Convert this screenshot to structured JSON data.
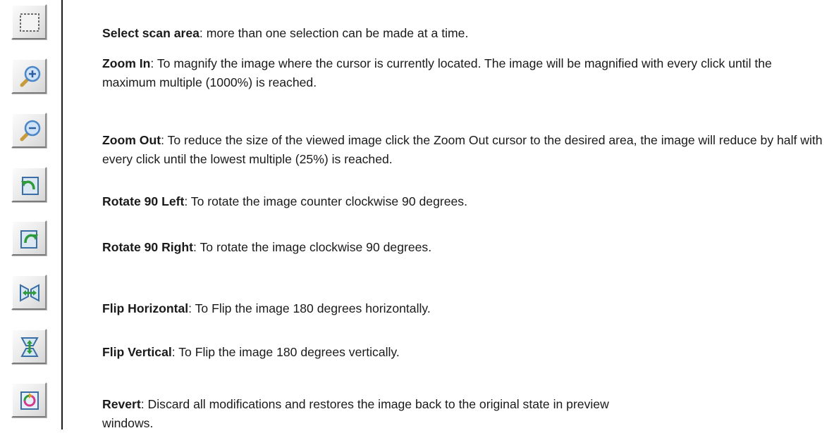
{
  "toolbar": {
    "buttons": [
      {
        "icon": "select-area-icon",
        "name": "Select scan area",
        "description": ": more than one selection can be made at a time."
      },
      {
        "icon": "zoom-in-icon",
        "name": "Zoom In",
        "description": ": To magnify the image where the cursor is currently located. The image will be magnified with every click until the maximum multiple (1000%) is reached."
      },
      {
        "icon": "zoom-out-icon",
        "name": "Zoom Out",
        "description": ": To reduce the size of the viewed image click the Zoom Out cursor to the desired area, the image will reduce by half with every click until the lowest multiple (25%) is reached."
      },
      {
        "icon": "rotate-left-icon",
        "name": "Rotate 90 Left",
        "description": ": To rotate the image counter clockwise 90 degrees."
      },
      {
        "icon": "rotate-right-icon",
        "name": "Rotate 90 Right",
        "description": ": To rotate the image clockwise 90 degrees."
      },
      {
        "icon": "flip-horizontal-icon",
        "name": "Flip Horizontal",
        "description": ": To Flip the image 180 degrees horizontally."
      },
      {
        "icon": "flip-vertical-icon",
        "name": "Flip Vertical",
        "description": ": To Flip the image 180 degrees vertically."
      },
      {
        "icon": "revert-icon",
        "name": "Revert",
        "description": ": Discard all modifications and restores the image back to the original state in preview windows."
      }
    ]
  },
  "colors": {
    "text": "#1a1a1a",
    "button_face": "#e9e9e9",
    "magnifier_blue": "#4b86c9",
    "handle_gold": "#c79a3c",
    "arrow_green": "#2f9a3c"
  }
}
